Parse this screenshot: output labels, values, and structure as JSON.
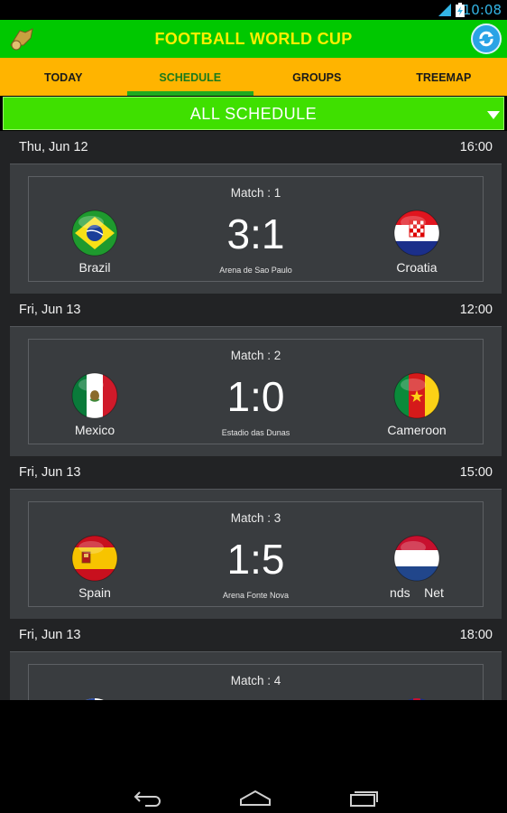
{
  "status": {
    "time": "10:08",
    "network": "3G"
  },
  "app": {
    "title": "FOOTBALL WORLD CUP"
  },
  "tabs": [
    {
      "label": "TODAY",
      "active": false
    },
    {
      "label": "SCHEDULE",
      "active": true
    },
    {
      "label": "GROUPS",
      "active": false
    },
    {
      "label": "TREEMAP",
      "active": false
    }
  ],
  "filter": {
    "label": "ALL SCHEDULE"
  },
  "matches": [
    {
      "date": "Thu, Jun 12",
      "time": "16:00",
      "match_label": "Match : 1",
      "home": "Brazil",
      "away": "Croatia",
      "score": "3:1",
      "venue": "Arena de Sao Paulo"
    },
    {
      "date": "Fri, Jun 13",
      "time": "12:00",
      "match_label": "Match : 2",
      "home": "Mexico",
      "away": "Cameroon",
      "score": "1:0",
      "venue": "Estadio das Dunas"
    },
    {
      "date": "Fri, Jun 13",
      "time": "15:00",
      "match_label": "Match : 3",
      "home": "Spain",
      "away": "nds    Net",
      "score": "1:5",
      "venue": "Arena Fonte Nova"
    },
    {
      "date": "Fri, Jun 13",
      "time": "18:00",
      "match_label": "Match : 4"
    }
  ],
  "colors": {
    "appbar": "#00c800",
    "title": "#ffef00",
    "tabs": "#ffb400",
    "filter": "#3fe000",
    "accent": "#33b5e5"
  }
}
